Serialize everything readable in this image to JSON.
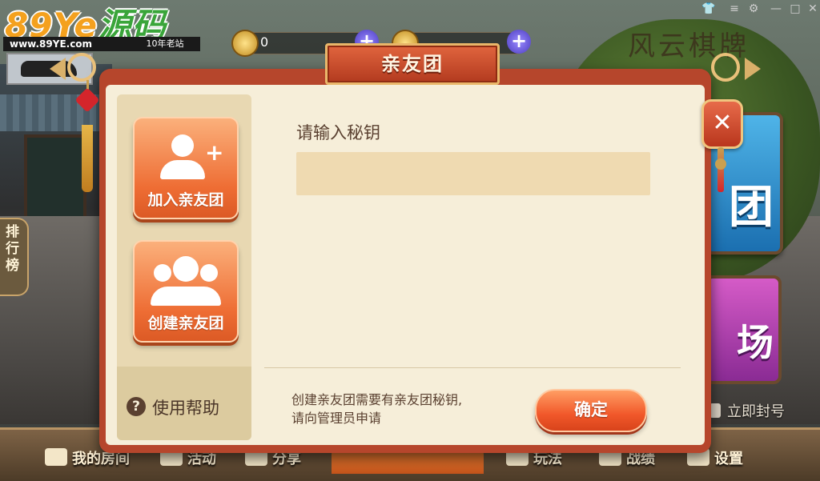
{
  "watermark": {
    "logo_num": "89Ye",
    "logo_cn": "源码",
    "url": "www.89YE.com",
    "tag": "10年老站"
  },
  "topbar": {
    "coins_value": "0",
    "coin_plus": "+",
    "gem_plus": "+"
  },
  "background": {
    "sign_title": "风云棋牌",
    "blue_tile_char": "团",
    "purple_tile_char": "场",
    "rank_tab": "排行榜",
    "report_text": "立即封号",
    "bottom_nav": [
      "我的房间",
      "活动",
      "分享",
      "玩法",
      "战绩",
      "设置"
    ]
  },
  "dialog": {
    "title": "亲友团",
    "close_glyph": "✕",
    "side": {
      "join_label": "加入亲友团",
      "create_label": "创建亲友团",
      "help_icon": "?",
      "help_label": "使用帮助"
    },
    "key_label": "请输入秘钥",
    "key_value": "",
    "key_placeholder": "",
    "hint_line1": "创建亲友团需要有亲友团秘钥,",
    "hint_line2": "请向管理员申请",
    "confirm_label": "确定"
  },
  "colors": {
    "dialog_frame": "#b6462c",
    "panel_bg": "#f6eed9",
    "button_orange": "#f1582a"
  }
}
